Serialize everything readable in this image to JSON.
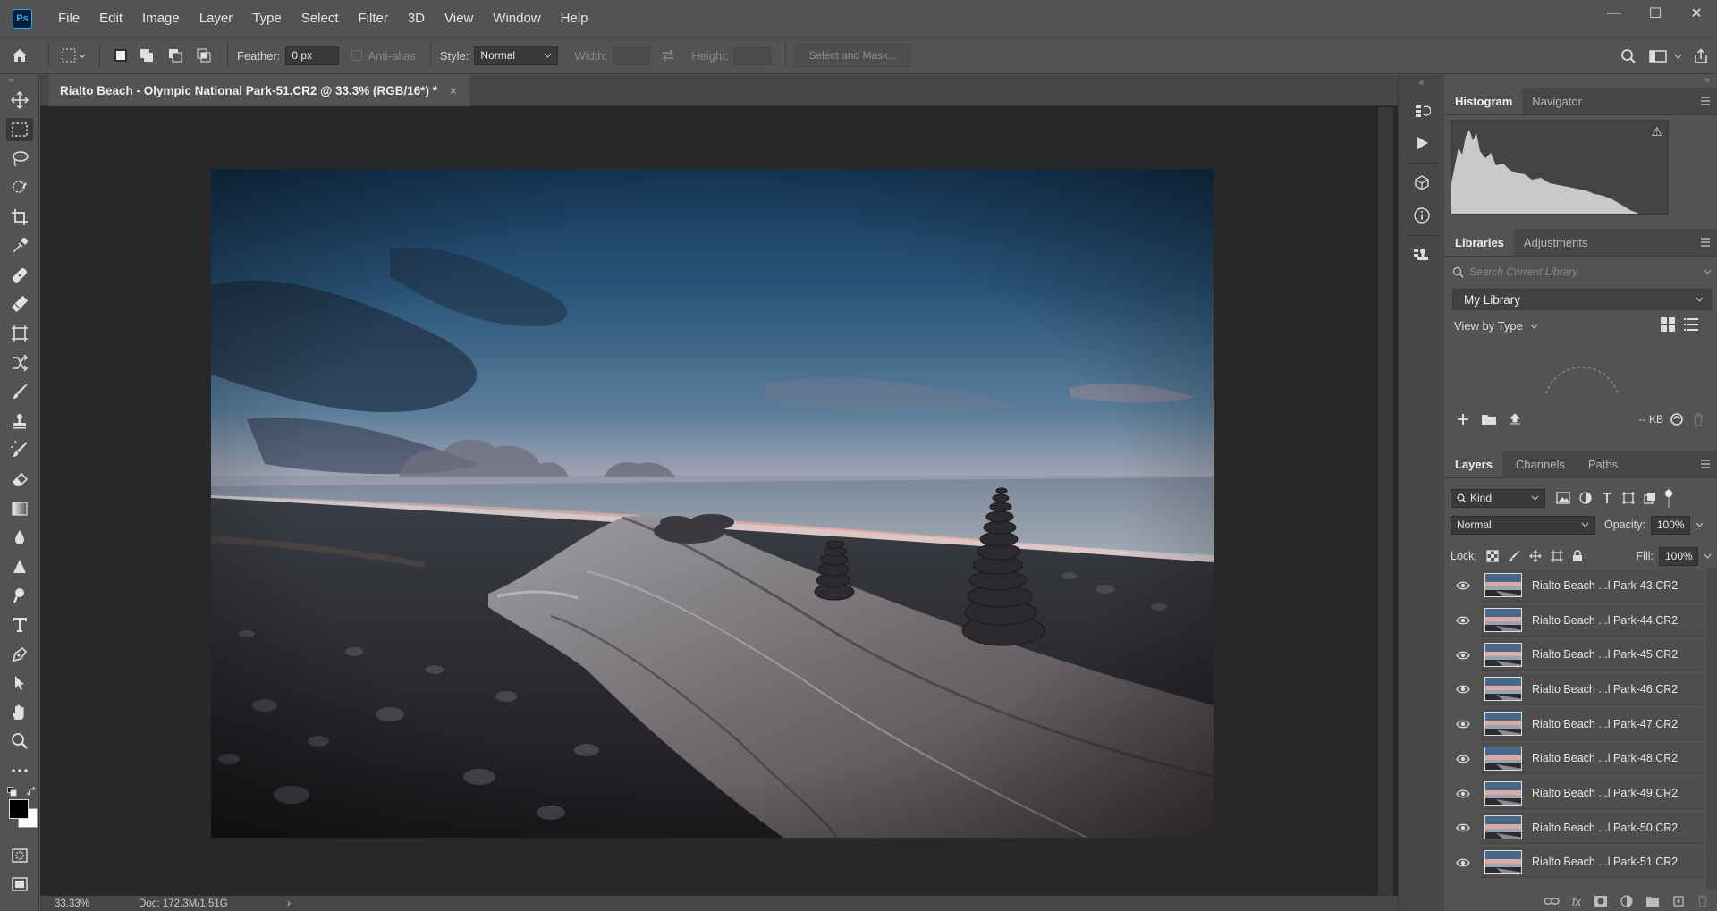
{
  "app": {
    "logo": "Ps"
  },
  "menu": [
    "File",
    "Edit",
    "Image",
    "Layer",
    "Type",
    "Select",
    "Filter",
    "3D",
    "View",
    "Window",
    "Help"
  ],
  "window_controls": {
    "minimize": "—",
    "maximize": "☐",
    "close": "✕"
  },
  "options": {
    "feather_label": "Feather:",
    "feather_value": "0 px",
    "antialias_label": "Anti-alias",
    "style_label": "Style:",
    "style_value": "Normal",
    "width_label": "Width:",
    "height_label": "Height:",
    "select_mask_label": "Select and Mask..."
  },
  "document": {
    "tab_title": "Rialto Beach - Olympic National Park-51.CR2 @ 33.3% (RGB/16*) *",
    "tab_close": "×"
  },
  "status": {
    "zoom": "33.33%",
    "doc_info": "Doc: 172.3M/1.51G",
    "arrow": "›"
  },
  "histogram_panel": {
    "tabs": [
      "Histogram",
      "Navigator"
    ],
    "warning_icon": "⚠"
  },
  "libraries_panel": {
    "tabs": [
      "Libraries",
      "Adjustments"
    ],
    "search_placeholder": "Search Current Library",
    "library_name": "My Library",
    "view_by": "View by Type",
    "size_label": "-- KB"
  },
  "layers_panel": {
    "tabs": [
      "Layers",
      "Channels",
      "Paths"
    ],
    "filter_kind": "Kind",
    "blend_mode": "Normal",
    "opacity_label": "Opacity:",
    "opacity_value": "100%",
    "lock_label": "Lock:",
    "fill_label": "Fill:",
    "fill_value": "100%",
    "layers": [
      "Rialto Beach ...l Park-43.CR2",
      "Rialto Beach ...l Park-44.CR2",
      "Rialto Beach ...l Park-45.CR2",
      "Rialto Beach ...l Park-46.CR2",
      "Rialto Beach ...l Park-47.CR2",
      "Rialto Beach ...l Park-48.CR2",
      "Rialto Beach ...l Park-49.CR2",
      "Rialto Beach ...l Park-50.CR2",
      "Rialto Beach ...l Park-51.CR2"
    ],
    "fx_label": "fx"
  },
  "colors": {
    "accent": "#31a8ff",
    "ui_bg": "#535353",
    "canvas_bg": "#282828"
  }
}
